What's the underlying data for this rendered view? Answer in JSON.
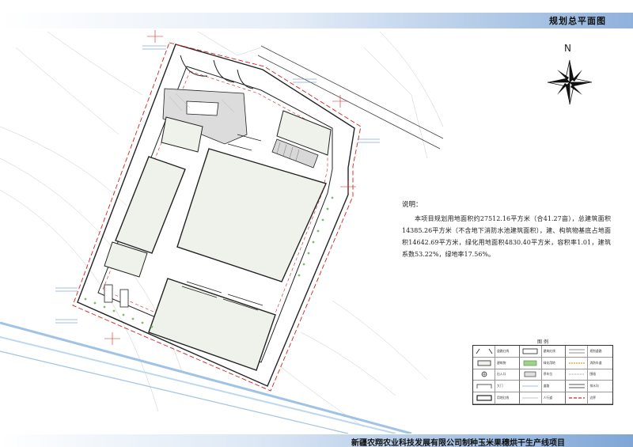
{
  "header": {
    "title": "规划总平面图"
  },
  "compass": {
    "label": "N"
  },
  "notes": {
    "title": "说明：",
    "body": "本项目规划用地面积约27512.16平方米（合41.27亩），总建筑面积14385.26平方米（不含地下消防水池建筑面积），建、构筑物基底占地面积14642.69平方米，绿化用地面积4830.40平方米，容积率1.01，建筑系数53.22%，绿地率17.56%。"
  },
  "legend": {
    "title": "图 例",
    "items": [
      {
        "label": "道路红线"
      },
      {
        "label": "建筑红线"
      },
      {
        "label": "规划道路"
      },
      {
        "label": "建筑物"
      },
      {
        "label": "绿化用地"
      },
      {
        "label": "消防车道"
      },
      {
        "label": "出入口"
      },
      {
        "label": "停车位"
      },
      {
        "label": "围墙"
      },
      {
        "label": "大门"
      },
      {
        "label": "道路"
      },
      {
        "label": "排水沟"
      },
      {
        "label": "用地红线"
      },
      {
        "label": "人行道"
      },
      {
        "label": "边界"
      }
    ]
  },
  "colors": {
    "red_line": "#d62020",
    "building_fill": "#eef2ea",
    "plaza_fill": "#dcdcdc",
    "road_line": "#222222",
    "river": "#bcd7ee"
  },
  "footer": {
    "title": "新疆农翔农业科技发展有限公司制种玉米果穗烘干生产线项目"
  }
}
